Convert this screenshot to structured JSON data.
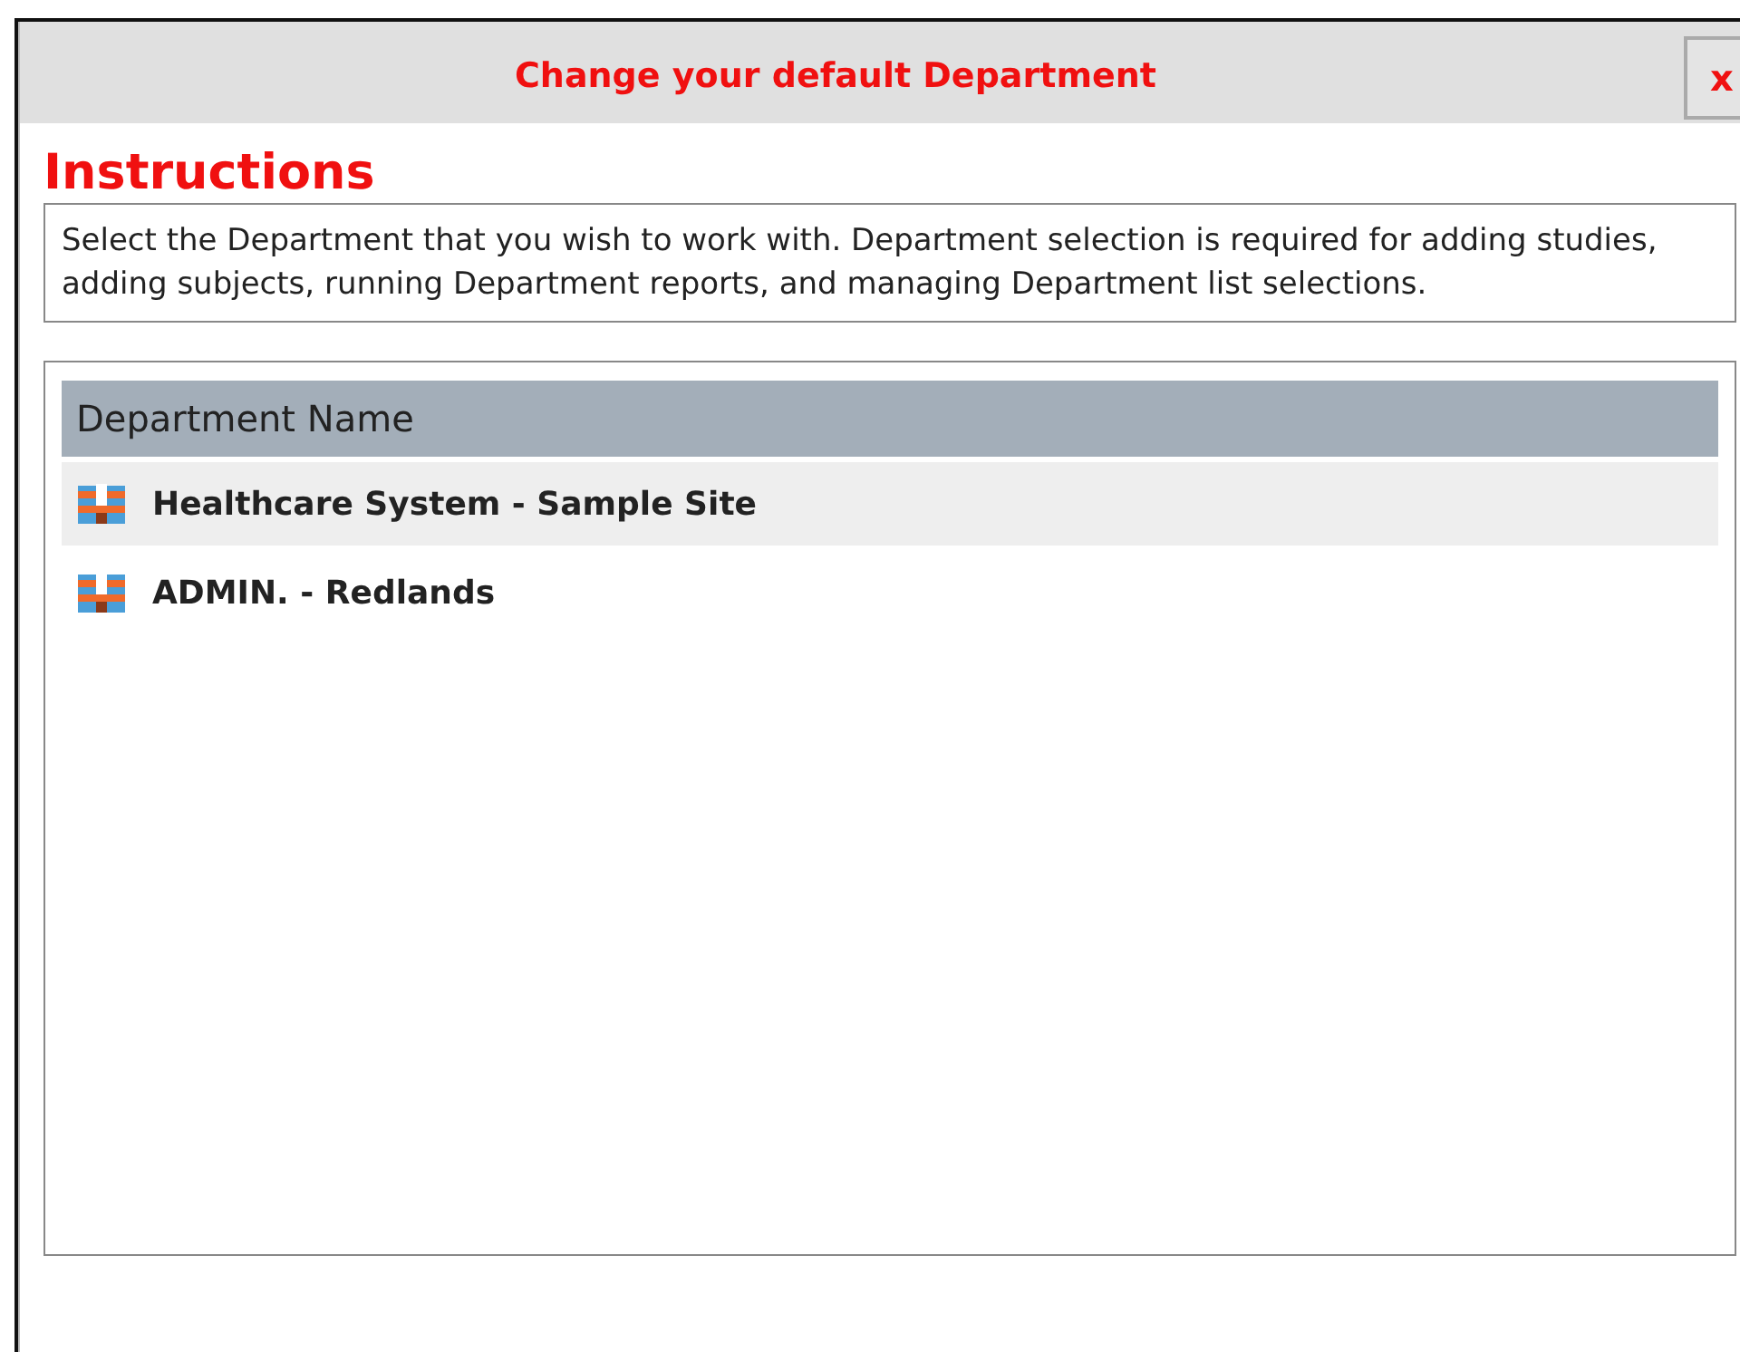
{
  "dialog": {
    "title": "Change your default Department",
    "close_label": "x"
  },
  "instructions": {
    "heading": "Instructions",
    "text": "Select the Department that you wish to work with. Department selection is required for adding studies, adding subjects, running Department reports, and managing Department list selections."
  },
  "table": {
    "columns": [
      "Department Name"
    ],
    "rows": [
      {
        "name": "Healthcare System - Sample Site",
        "selected": true
      },
      {
        "name": "ADMIN. - Redlands",
        "selected": false
      }
    ]
  }
}
